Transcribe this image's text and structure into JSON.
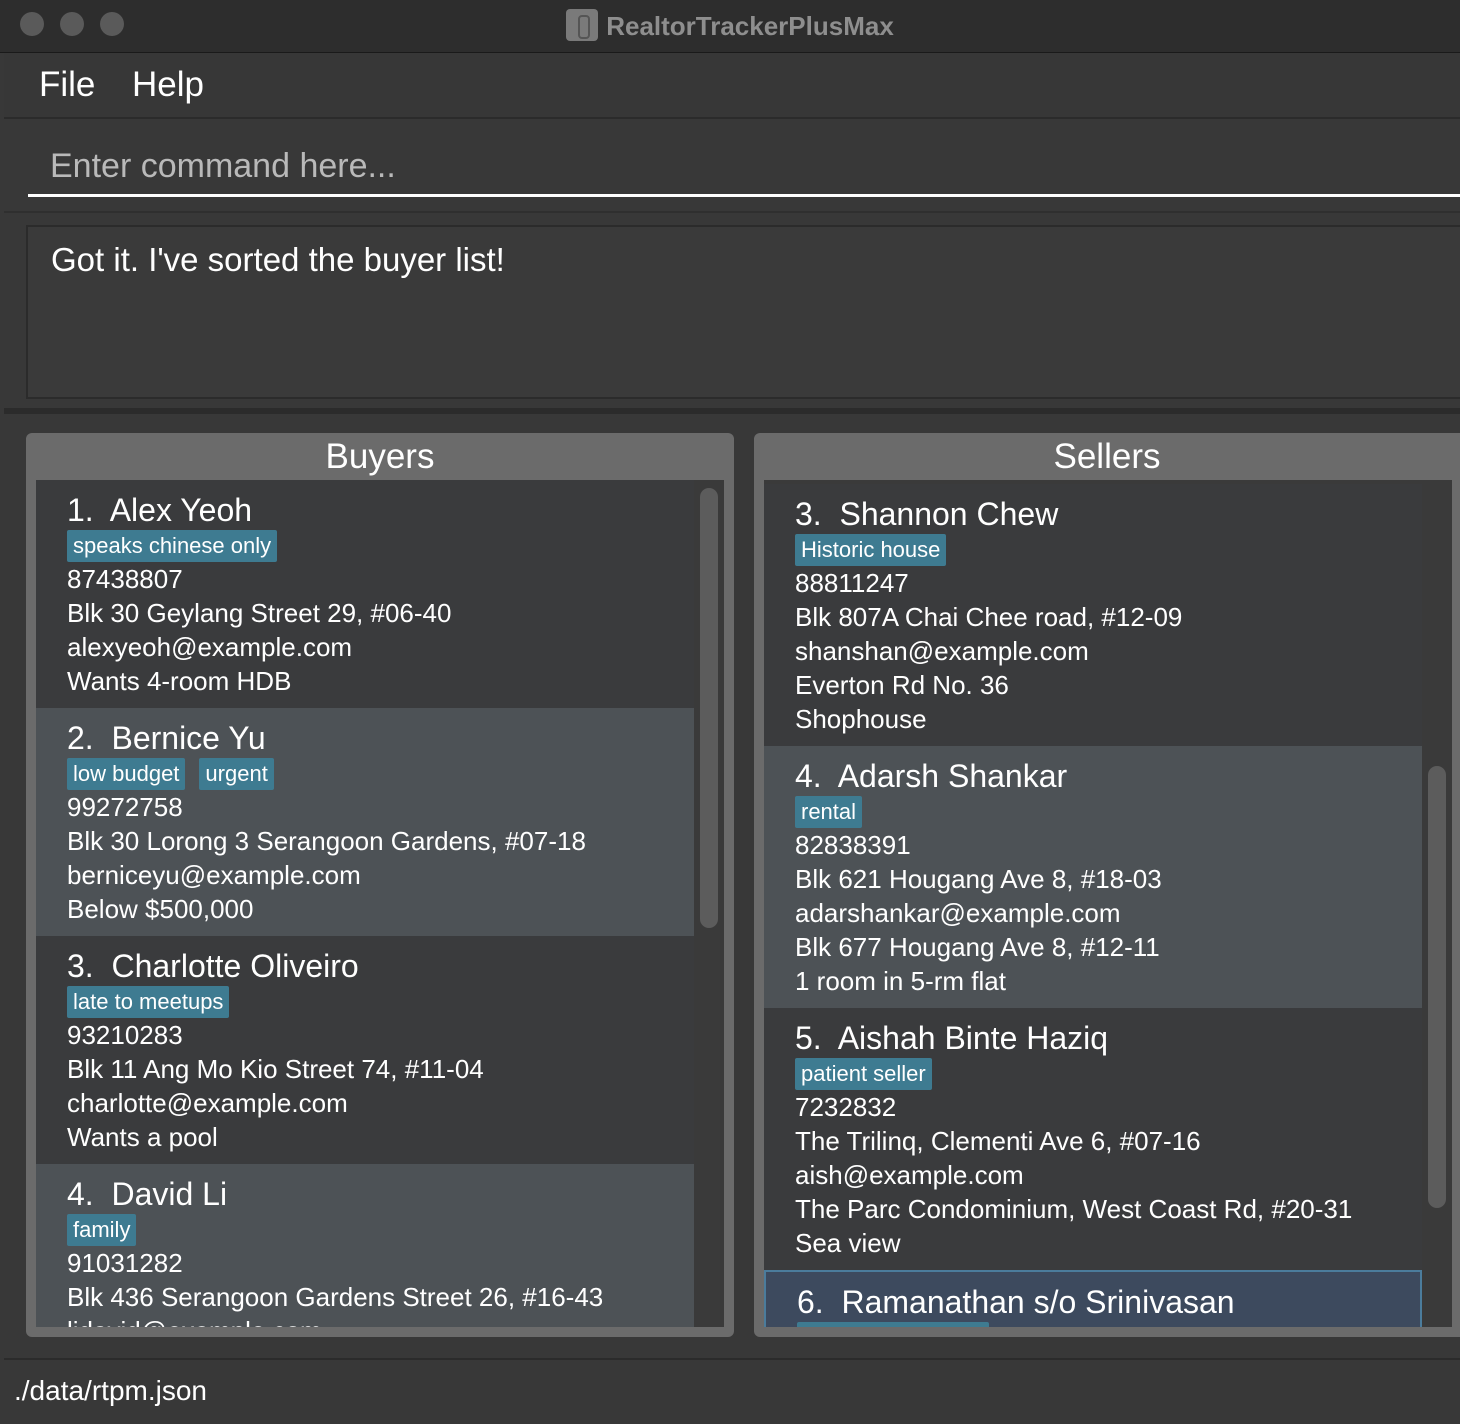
{
  "window": {
    "title": "RealtorTrackerPlusMax"
  },
  "menu": {
    "file": "File",
    "help": "Help"
  },
  "command": {
    "placeholder": "Enter command here..."
  },
  "result": {
    "message": "Got it. I've sorted the buyer list!"
  },
  "buyers": {
    "title": "Buyers",
    "items": [
      {
        "index": "1.",
        "name": "Alex Yeoh",
        "tags": [
          "speaks chinese only"
        ],
        "phone": "87438807",
        "address": "Blk 30 Geylang Street 29, #06-40",
        "email": "alexyeoh@example.com",
        "note": "Wants 4-room HDB"
      },
      {
        "index": "2.",
        "name": "Bernice Yu",
        "tags": [
          "low budget",
          "urgent"
        ],
        "phone": "99272758",
        "address": "Blk 30 Lorong 3 Serangoon Gardens, #07-18",
        "email": "berniceyu@example.com",
        "note": "Below $500,000"
      },
      {
        "index": "3.",
        "name": "Charlotte Oliveiro",
        "tags": [
          "late to meetups"
        ],
        "phone": "93210283",
        "address": "Blk 11 Ang Mo Kio Street 74, #11-04",
        "email": "charlotte@example.com",
        "note": "Wants a pool"
      },
      {
        "index": "4.",
        "name": "David Li",
        "tags": [
          "family"
        ],
        "phone": "91031282",
        "address": "Blk 436 Serangoon Gardens Street 26, #16-43",
        "email": "lidavid@example.com",
        "note": ""
      }
    ]
  },
  "sellers": {
    "title": "Sellers",
    "items": [
      {
        "index": "3.",
        "name": "Shannon Chew",
        "tags": [
          "Historic house"
        ],
        "phone": "88811247",
        "address": "Blk 807A Chai Chee road, #12-09",
        "email": "shanshan@example.com",
        "house_address": "Everton Rd No. 36",
        "house_info": "Shophouse"
      },
      {
        "index": "4.",
        "name": "Adarsh Shankar",
        "tags": [
          "rental"
        ],
        "phone": "82838391",
        "address": "Blk 621 Hougang Ave 8, #18-03",
        "email": "adarshankar@example.com",
        "house_address": "Blk 677 Hougang Ave 8, #12-11",
        "house_info": "1 room in 5-rm flat"
      },
      {
        "index": "5.",
        "name": "Aishah Binte Haziq",
        "tags": [
          "patient seller"
        ],
        "phone": "7232832",
        "address": "The Trilinq, Clementi Ave 6, #07-16",
        "email": "aish@example.com",
        "house_address": "The Parc Condominium, West Coast Rd, #20-31",
        "house_info": "Sea view"
      },
      {
        "index": "6.",
        "name": "Ramanathan s/o Srinivasan",
        "tags": [],
        "phone": "",
        "address": "",
        "email": "",
        "house_address": "",
        "house_info": ""
      }
    ]
  },
  "status": {
    "path": "./data/rtpm.json"
  }
}
